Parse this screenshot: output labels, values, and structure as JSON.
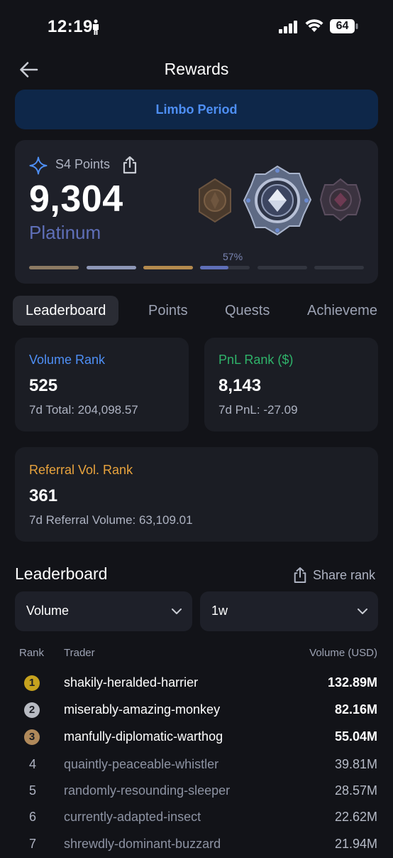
{
  "status_bar": {
    "time": "12:19",
    "battery": "64"
  },
  "header": {
    "title": "Rewards"
  },
  "banner": {
    "label": "Limbo Period"
  },
  "points_card": {
    "season_label": "S4 Points",
    "points": "9,304",
    "tier": "Platinum",
    "progress_label": "57%",
    "tier_segments": [
      {
        "color": "#8c7a63",
        "progress": 1.0
      },
      {
        "color": "#8e97b7",
        "progress": 1.0
      },
      {
        "color": "#b48a4e",
        "progress": 1.0
      },
      {
        "color": "#5f6fb8",
        "progress": 0.57
      },
      {
        "color": "#32353f",
        "progress": 0
      },
      {
        "color": "#32353f",
        "progress": 0
      }
    ]
  },
  "tabs": [
    "Leaderboard",
    "Points",
    "Quests",
    "Achieveme"
  ],
  "stats": {
    "volume": {
      "title": "Volume Rank",
      "value": "525",
      "sub": "7d Total: 204,098.57",
      "color": "#4e8ff5"
    },
    "pnl": {
      "title": "PnL Rank ($)",
      "value": "8,143",
      "sub": "7d PnL: -27.09",
      "color": "#2fb36a"
    },
    "referral": {
      "title": "Referral Vol. Rank",
      "value": "361",
      "sub": "7d Referral Volume: 63,109.01",
      "color": "#e8a33d"
    }
  },
  "leaderboard": {
    "title": "Leaderboard",
    "share_label": "Share rank",
    "metric_select": "Volume",
    "period_select": "1w",
    "columns": {
      "rank": "Rank",
      "trader": "Trader",
      "volume": "Volume (USD)"
    },
    "rows": [
      {
        "rank": "1",
        "trader": "shakily-heralded-harrier",
        "volume": "132.89M"
      },
      {
        "rank": "2",
        "trader": "miserably-amazing-monkey",
        "volume": "82.16M"
      },
      {
        "rank": "3",
        "trader": "manfully-diplomatic-warthog",
        "volume": "55.04M"
      },
      {
        "rank": "4",
        "trader": "quaintly-peaceable-whistler",
        "volume": "39.81M"
      },
      {
        "rank": "5",
        "trader": "randomly-resounding-sleeper",
        "volume": "28.57M"
      },
      {
        "rank": "6",
        "trader": "currently-adapted-insect",
        "volume": "22.62M"
      },
      {
        "rank": "7",
        "trader": "shrewdly-dominant-buzzard",
        "volume": "21.94M"
      }
    ]
  },
  "colors": {
    "background": "#121318",
    "card": "#1b1d24",
    "accent_blue": "#4e8ff5",
    "gold": "#c6a21e",
    "silver": "#b8bbc2",
    "bronze": "#b0895a"
  }
}
